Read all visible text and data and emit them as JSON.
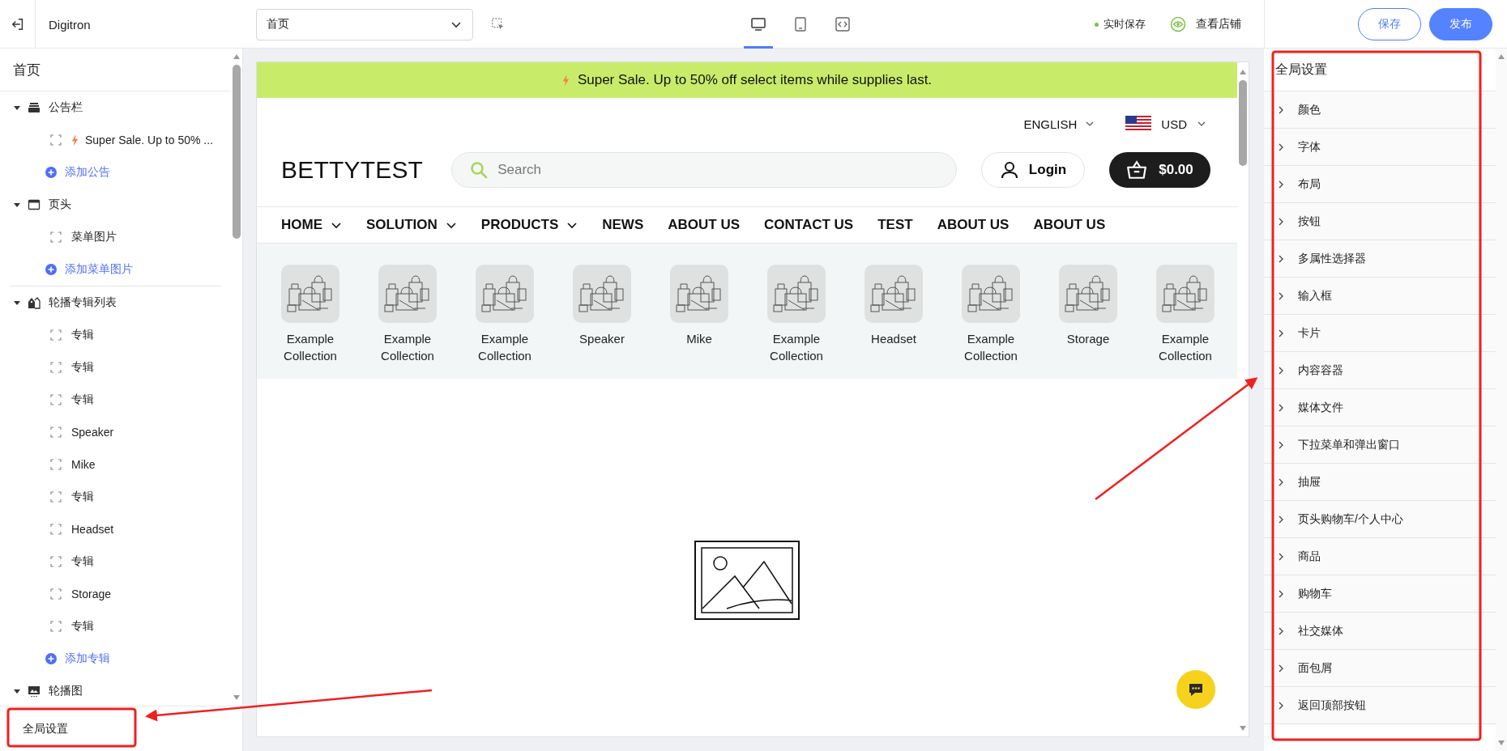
{
  "topbar": {
    "app_name": "Digitron",
    "page_select": {
      "value": "首页"
    },
    "device_modes": [
      {
        "kind": "desktop",
        "selected": true
      },
      {
        "kind": "tablet",
        "selected": false
      },
      {
        "kind": "code",
        "selected": false
      }
    ],
    "autosave": "实时保存",
    "view_store": "查看店铺",
    "save_button": "保存",
    "publish_button": "发布"
  },
  "outline": {
    "title": "首页",
    "sections": [
      {
        "blocks": [
          {
            "label": "公告栏",
            "kind": "announcement",
            "expanded": true,
            "children": [
              {
                "kind": "announcement",
                "label": "Super Sale. Up to 50% ..."
              },
              {
                "kind": "add",
                "label": "添加公告"
              }
            ]
          },
          {
            "label": "页头",
            "kind": "header",
            "expanded": true,
            "children": [
              {
                "kind": "item",
                "label": "菜单图片"
              },
              {
                "kind": "add",
                "label": "添加菜单图片"
              }
            ]
          }
        ]
      },
      {
        "blocks": [
          {
            "label": "轮播专辑列表",
            "kind": "collection",
            "expanded": true,
            "children": [
              {
                "kind": "item",
                "label": "专辑"
              },
              {
                "kind": "item",
                "label": "专辑"
              },
              {
                "kind": "item",
                "label": "专辑"
              },
              {
                "kind": "item",
                "label": "Speaker"
              },
              {
                "kind": "item",
                "label": "Mike"
              },
              {
                "kind": "item",
                "label": "专辑"
              },
              {
                "kind": "item",
                "label": "Headset"
              },
              {
                "kind": "item",
                "label": "专辑"
              },
              {
                "kind": "item",
                "label": "Storage"
              },
              {
                "kind": "item",
                "label": "专辑"
              },
              {
                "kind": "add",
                "label": "添加专辑"
              }
            ]
          },
          {
            "label": "轮播图",
            "kind": "slideshow",
            "expanded": true
          }
        ]
      }
    ],
    "footer": "全局设置"
  },
  "preview": {
    "announcement": "Super Sale. Up to 50% off select items while supplies last.",
    "language": "ENGLISH",
    "currency": "USD",
    "logo": "BETTYTEST",
    "search": {
      "placeholder": "Search"
    },
    "login": "Login",
    "cart_total": "$0.00",
    "nav": [
      {
        "label": "HOME",
        "dropdown": true
      },
      {
        "label": "SOLUTION",
        "dropdown": true
      },
      {
        "label": "PRODUCTS",
        "dropdown": true
      },
      {
        "label": "NEWS",
        "dropdown": false
      },
      {
        "label": "ABOUT US",
        "dropdown": false
      },
      {
        "label": "CONTACT US",
        "dropdown": false
      },
      {
        "label": "TEST",
        "dropdown": false
      },
      {
        "label": "ABOUT US",
        "dropdown": false
      },
      {
        "label": "ABOUT US",
        "dropdown": false
      }
    ],
    "collections": [
      {
        "label": "Example Collection"
      },
      {
        "label": "Example Collection"
      },
      {
        "label": "Example Collection"
      },
      {
        "label": "Speaker"
      },
      {
        "label": "Mike"
      },
      {
        "label": "Example Collection"
      },
      {
        "label": "Headset"
      },
      {
        "label": "Example Collection"
      },
      {
        "label": "Storage"
      },
      {
        "label": "Example Collection"
      }
    ]
  },
  "settings": {
    "title": "全局设置",
    "items": [
      {
        "label": "颜色",
        "expanded": false
      },
      {
        "label": "字体",
        "expanded": false
      },
      {
        "label": "布局",
        "expanded": false
      },
      {
        "label": "按钮",
        "expanded": false
      },
      {
        "label": "多属性选择器",
        "expanded": false
      },
      {
        "label": "输入框",
        "expanded": false
      },
      {
        "label": "卡片",
        "expanded": false
      },
      {
        "label": "内容容器",
        "expanded": false
      },
      {
        "label": "媒体文件",
        "expanded": false
      },
      {
        "label": "下拉菜单和弹出窗口",
        "expanded": false
      },
      {
        "label": "抽屉",
        "expanded": false
      },
      {
        "label": "页头购物车/个人中心",
        "expanded": false
      },
      {
        "label": "商品",
        "expanded": false
      },
      {
        "label": "购物车",
        "expanded": false
      },
      {
        "label": "社交媒体",
        "expanded": false
      },
      {
        "label": "面包屑",
        "expanded": false
      },
      {
        "label": "返回顶部按钮",
        "expanded": false
      }
    ]
  }
}
